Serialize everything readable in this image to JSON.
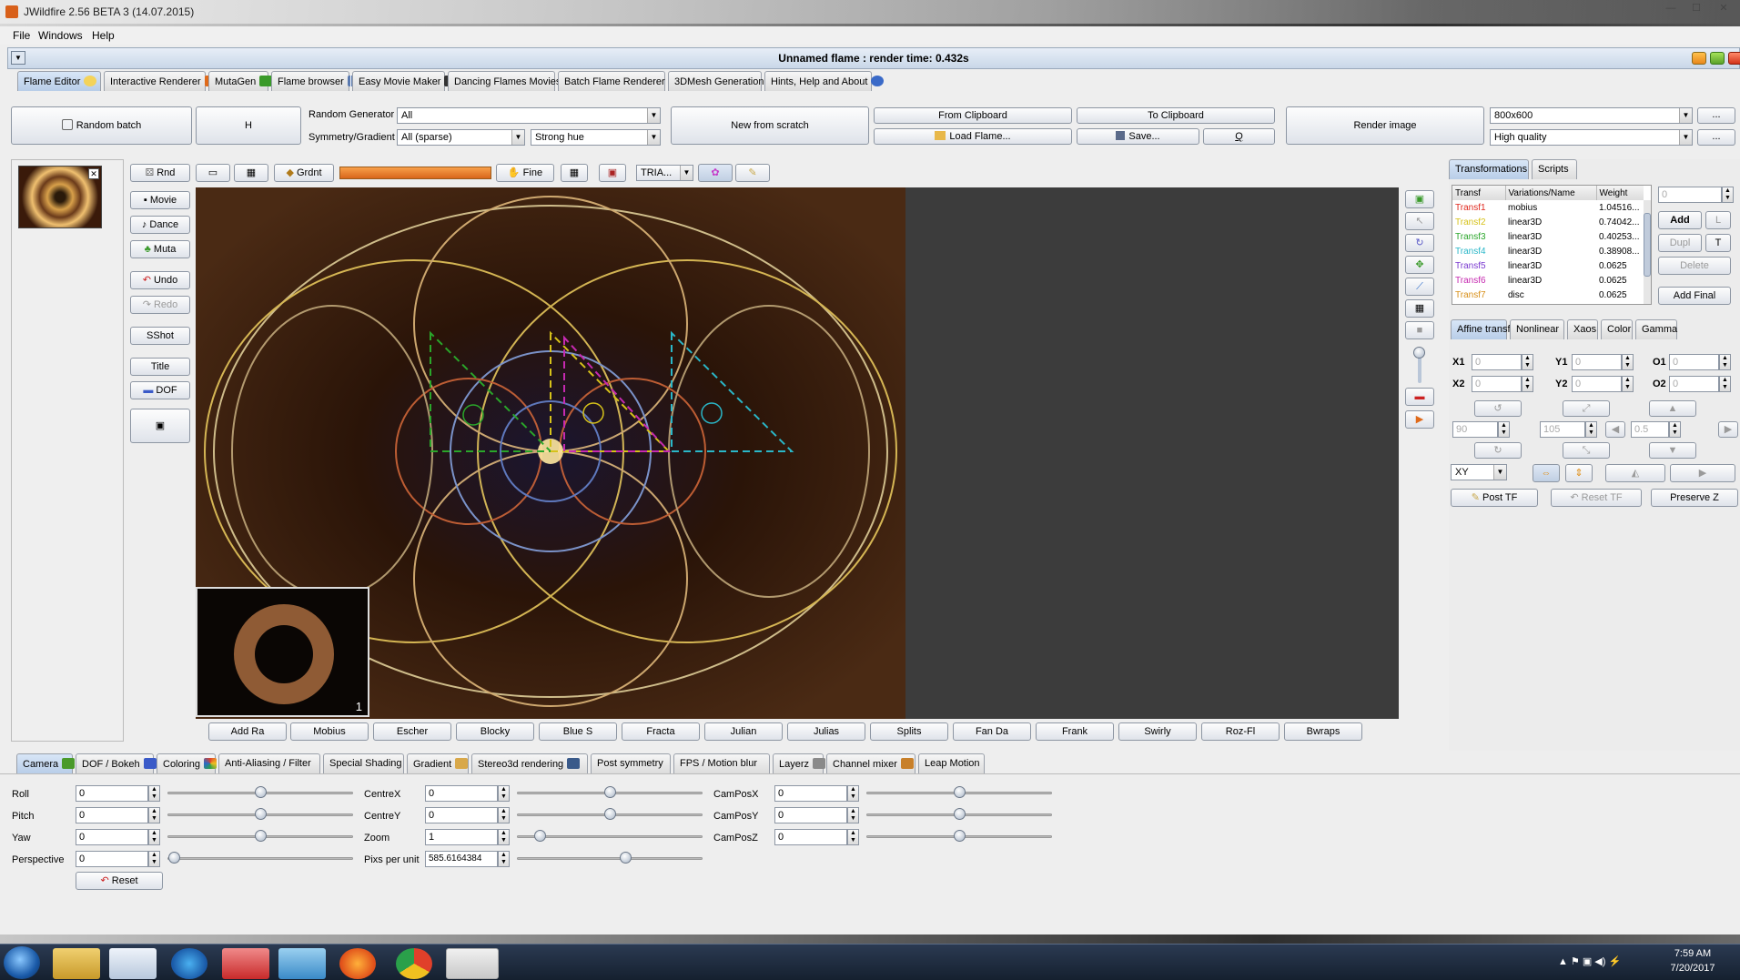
{
  "app": {
    "window_title": "JWildfire 2.56 BETA 3 (14.07.2015)",
    "frame_title": "Unnamed flame : render time: 0.432s"
  },
  "menu": [
    "File",
    "Windows",
    "Help"
  ],
  "tabs": [
    {
      "label": "Flame Editor",
      "icon": "sun-icon"
    },
    {
      "label": "Interactive Renderer",
      "icon": "renderer-icon"
    },
    {
      "label": "MutaGen",
      "icon": "tree-icon"
    },
    {
      "label": "Flame browser",
      "icon": "grid-icon"
    },
    {
      "label": "Easy Movie Maker",
      "icon": "clapper-icon"
    },
    {
      "label": "Dancing Flames Movies",
      "icon": "dancer-icon"
    },
    {
      "label": "Batch Flame Renderer",
      "icon": "batch-icon"
    },
    {
      "label": "3DMesh Generation",
      "icon": "ball-icon"
    },
    {
      "label": "Hints, Help and About",
      "icon": "info-icon"
    }
  ],
  "toolbar": {
    "random_batch": "Random batch",
    "h": "H",
    "random_generator_label": "Random Generator",
    "random_generator_value": "All",
    "symmetry_label": "Symmetry/Gradient",
    "symmetry_value": "All (sparse)",
    "gradient_value": "Strong hue",
    "new_from_scratch": "New from scratch",
    "from_clipboard": "From Clipboard",
    "to_clipboard": "To Clipboard",
    "load_flame": "Load Flame...",
    "save": "Save...",
    "q": "Q",
    "render_image": "Render image",
    "resolution": "800x600",
    "quality": "High quality",
    "ellipsis": "..."
  },
  "editbar": {
    "rnd": "Rnd",
    "grdnt": "Grdnt",
    "fine": "Fine",
    "tria": "TRIA..."
  },
  "leftbuttons": {
    "movie": "Movie",
    "dance": "Dance",
    "muta": "Muta",
    "undo": "Undo",
    "redo": "Redo",
    "sshot": "SShot",
    "title": "Title",
    "dof": "DOF"
  },
  "preview_number": "1",
  "scripts": [
    "Add Ra",
    "Mobius",
    "Escher",
    "Blocky",
    "Blue S",
    "Fracta",
    "Julian",
    "Julias",
    "Splits",
    "Fan Da",
    "Frank",
    "Swirly",
    "Roz-Fl",
    "Bwraps"
  ],
  "right": {
    "tab_transformations": "Transformations",
    "tab_scripts": "Scripts",
    "col_transf": "Transf",
    "col_var": "Variations/Name",
    "col_weight": "Weight",
    "rows": [
      {
        "name": "Transf1",
        "var": "mobius",
        "weight": "1.04516...",
        "color": "#e0281e"
      },
      {
        "name": "Transf2",
        "var": "linear3D",
        "weight": "0.74042...",
        "color": "#d6c21a"
      },
      {
        "name": "Transf3",
        "var": "linear3D",
        "weight": "0.40253...",
        "color": "#2aa62a"
      },
      {
        "name": "Transf4",
        "var": "linear3D",
        "weight": "0.38908...",
        "color": "#2ab7c8"
      },
      {
        "name": "Transf5",
        "var": "linear3D",
        "weight": "0.0625",
        "color": "#7a3ad0"
      },
      {
        "name": "Transf6",
        "var": "linear3D",
        "weight": "0.0625",
        "color": "#c62ab0"
      },
      {
        "name": "Transf7",
        "var": "disc",
        "weight": "0.0625",
        "color": "#d8901a"
      }
    ],
    "field_zero": "0",
    "add": "Add",
    "l": "L",
    "dupl": "Dupl",
    "t": "T",
    "delete": "Delete",
    "add_final": "Add Final",
    "subtabs": [
      "Affine transf",
      "Nonlinear",
      "Xaos",
      "Color",
      "Gamma"
    ],
    "x1": "X1",
    "y1": "Y1",
    "o1": "O1",
    "x2": "X2",
    "y2": "Y2",
    "o2": "O2",
    "v90": "90",
    "v105": "105",
    "v05": "0.5",
    "xy": "XY",
    "post_tf": "Post TF",
    "reset_tf": "Reset TF",
    "preserve_z": "Preserve Z"
  },
  "bottom_tabs": [
    {
      "label": "Camera",
      "icon": "camera-icon"
    },
    {
      "label": "DOF / Bokeh",
      "icon": "flag-icon"
    },
    {
      "label": "Coloring",
      "icon": "color-wheel-icon"
    },
    {
      "label": "Anti-Aliasing / Filter",
      "icon": ""
    },
    {
      "label": "Special Shading",
      "icon": ""
    },
    {
      "label": "Gradient",
      "icon": "palette-icon"
    },
    {
      "label": "Stereo3d rendering",
      "icon": "glasses-icon"
    },
    {
      "label": "Post symmetry",
      "icon": ""
    },
    {
      "label": "FPS / Motion blur",
      "icon": ""
    },
    {
      "label": "Layerz",
      "icon": "layers-icon"
    },
    {
      "label": "Channel mixer",
      "icon": "mixer-icon"
    },
    {
      "label": "Leap Motion",
      "icon": ""
    }
  ],
  "camera": {
    "roll_label": "Roll",
    "roll": "0",
    "pitch_label": "Pitch",
    "pitch": "0",
    "yaw_label": "Yaw",
    "yaw": "0",
    "perspective_label": "Perspective",
    "perspective": "0",
    "reset": "Reset",
    "centrex_label": "CentreX",
    "centrex": "0",
    "centrey_label": "CentreY",
    "centrey": "0",
    "zoom_label": "Zoom",
    "zoom": "1",
    "pixs_label": "Pixs per unit",
    "pixs": "585.6164384",
    "camposx_label": "CamPosX",
    "camposx": "0",
    "camposy_label": "CamPosY",
    "camposy": "0",
    "camposz_label": "CamPosZ",
    "camposz": "0"
  },
  "taskbar": {
    "time": "7:59 AM",
    "date": "7/20/2017"
  }
}
